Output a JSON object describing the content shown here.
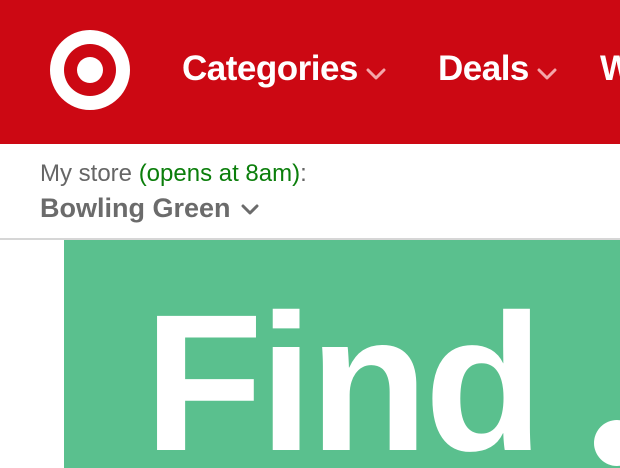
{
  "header": {
    "brand_color": "#cc0813",
    "logo_icon": "target-bullseye-icon",
    "nav": [
      {
        "label": "Categories",
        "icon": "chevron-down-icon"
      },
      {
        "label": "Deals",
        "icon": "chevron-down-icon"
      },
      {
        "label": "W"
      }
    ]
  },
  "store": {
    "prefix": "My store ",
    "status": "(opens at 8am)",
    "suffix": ":",
    "name": "Bowling Green",
    "status_color": "#0b7e0b",
    "icon": "chevron-down-icon"
  },
  "banner": {
    "text": "Find",
    "background": "#5ac08e"
  }
}
